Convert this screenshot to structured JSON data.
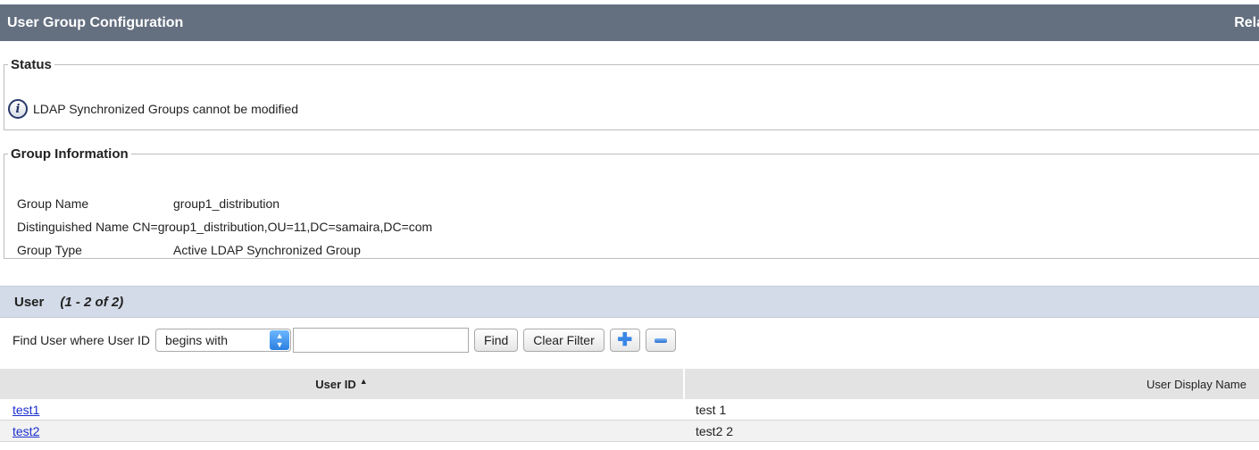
{
  "titlebar": {
    "title": "User Group Configuration",
    "related": "Rela"
  },
  "status": {
    "legend": "Status",
    "message": "LDAP Synchronized Groups cannot be modified"
  },
  "group_info": {
    "legend": "Group Information",
    "rows": [
      {
        "label": "Group Name",
        "value": "group1_distribution"
      },
      {
        "label": "Distinguished Name",
        "value": "CN=group1_distribution,OU=11,DC=samaira,DC=com"
      },
      {
        "label": "Group Type",
        "value": "Active LDAP Synchronized Group"
      }
    ]
  },
  "users": {
    "header": "User",
    "count": "(1 - 2 of 2)",
    "filter": {
      "label": "Find User where User ID",
      "select_value": "begins with",
      "search_value": "",
      "find_label": "Find",
      "clear_label": "Clear Filter"
    },
    "columns": [
      "User ID",
      "User Display Name"
    ],
    "rows": [
      {
        "user_id": "test1",
        "display_name": "test 1"
      },
      {
        "user_id": "test2",
        "display_name": "test2 2"
      }
    ]
  }
}
